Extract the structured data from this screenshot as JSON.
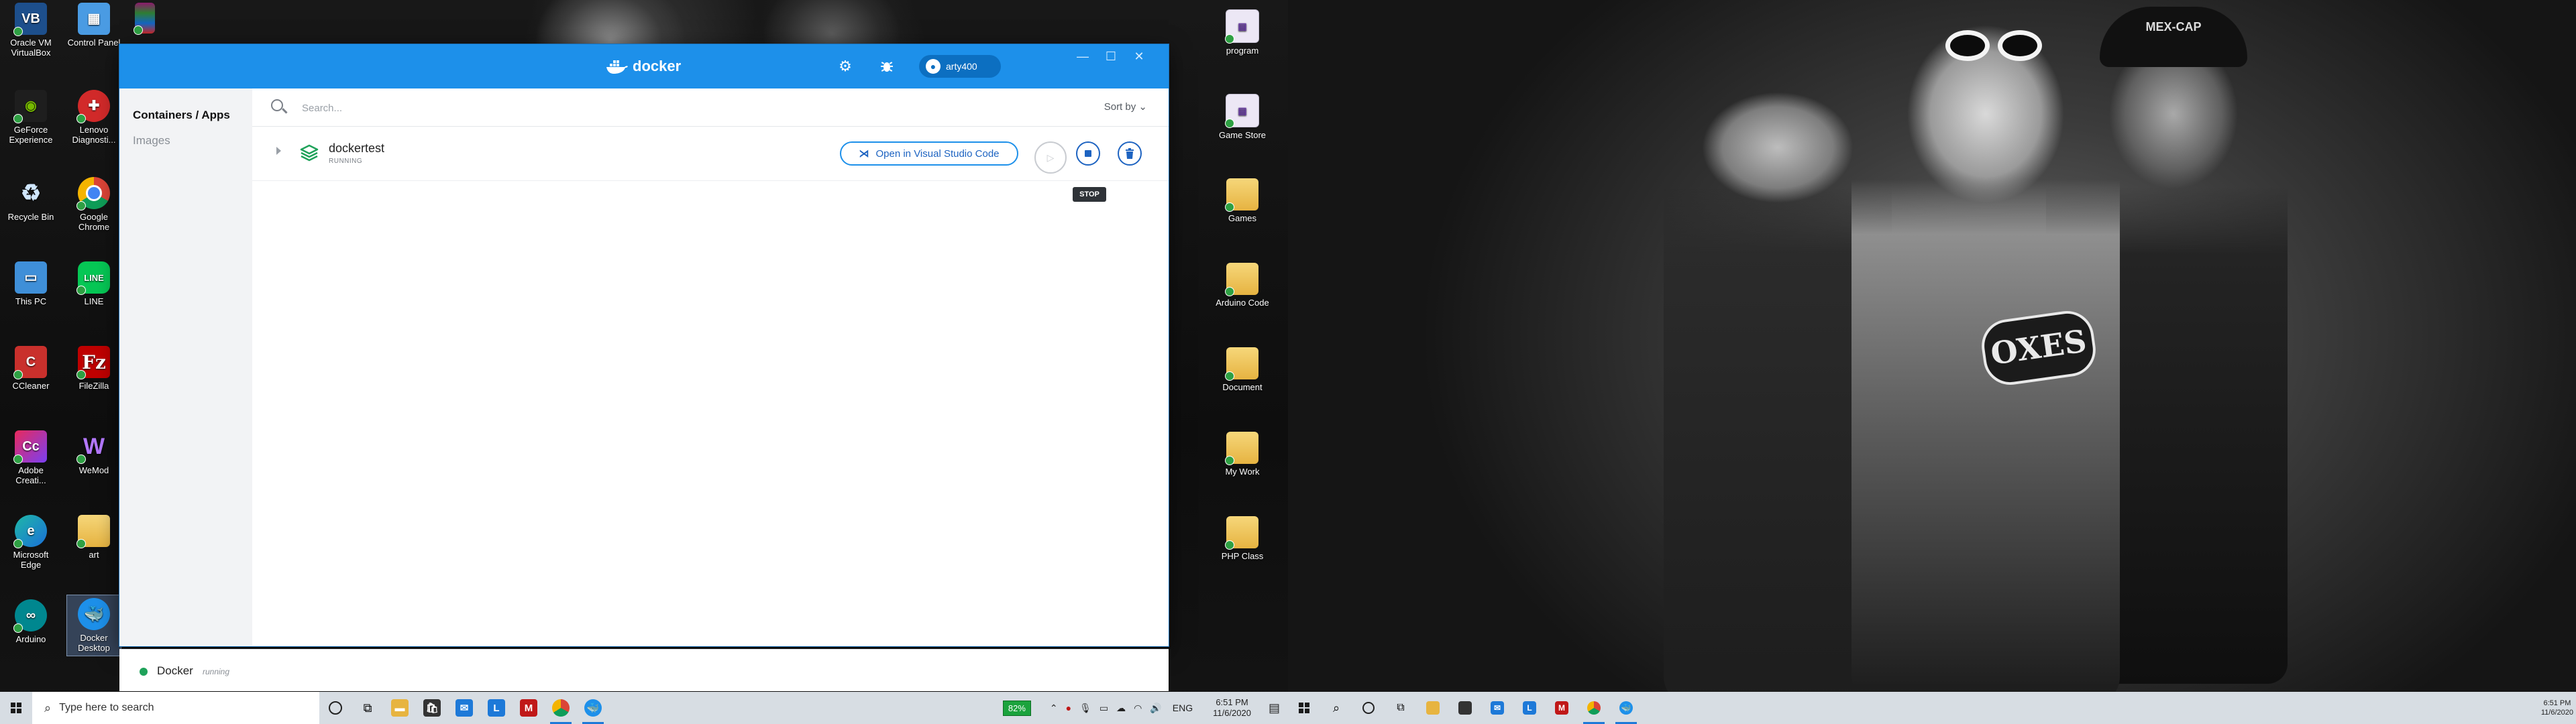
{
  "desktop_left": {
    "icons_col1": [
      "Oracle VM VirtualBox",
      "GeForce Experience",
      "Recycle Bin",
      "This PC",
      "CCleaner",
      "Adobe Creati...",
      "Microsoft Edge",
      "Arduino"
    ],
    "icons_col2": [
      "Control Panel",
      "Lenovo Diagnosti...",
      "Google Chrome",
      "LINE",
      "FileZilla",
      "WeMod",
      "art",
      "Docker Desktop"
    ],
    "icons_col3_partial": "WinRAR",
    "icons_right": [
      "program",
      "Game Store",
      "Games",
      "Arduino Code",
      "Document",
      "My Work",
      "PHP Class"
    ]
  },
  "docker": {
    "brand": "docker",
    "username": "arty400",
    "sidebar": {
      "active": "Containers / Apps",
      "inactive": "Images"
    },
    "search": {
      "placeholder": "Search..."
    },
    "sort_label": "Sort by",
    "container": {
      "name": "dockertest",
      "status": "RUNNING",
      "open_vscode": "Open in Visual Studio Code",
      "tooltip": "STOP"
    },
    "status": {
      "app": "Docker",
      "state": "running"
    }
  },
  "taskbar": {
    "search_placeholder": "Type here to search",
    "battery": "82%",
    "lang": "ENG",
    "time": "6:51 PM",
    "date": "11/6/2020",
    "time_secondary": "6:51 PM",
    "date_secondary": "11/6/2020"
  },
  "wallpaper": {
    "cap_text": "MEX-CAP",
    "shirt_text": "OXES"
  },
  "colors": {
    "docker_blue": "#1d90ea",
    "accent": "#1d63c1",
    "running_green": "#1fa25a",
    "battery_green": "#1ba33d"
  }
}
